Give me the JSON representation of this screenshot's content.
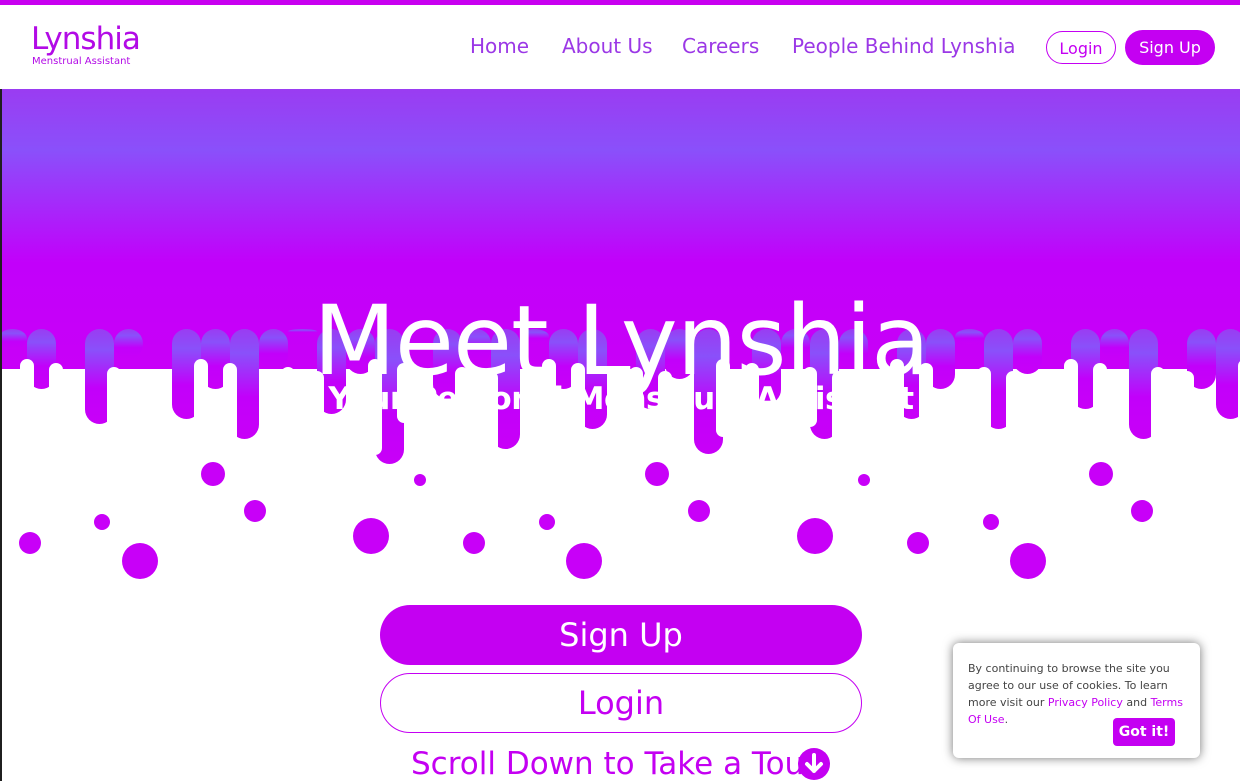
{
  "brand": {
    "name": "Lynshia",
    "tagline": "Menstrual Assistant"
  },
  "nav": {
    "links": [
      "Home",
      "About Us",
      "Careers",
      "People Behind Lynshia"
    ],
    "login_label": "Login",
    "signup_label": "Sign Up"
  },
  "hero": {
    "title": "Meet Lynshia",
    "subtitle": "Your Personal Menstrual Assistant"
  },
  "cta": {
    "signup_label": "Sign Up",
    "login_label": "Login",
    "tour_label": "Scroll Down to Take a Tour",
    "tour_icon": "arrow-down-circle-icon"
  },
  "cookie": {
    "text_before": "By continuing to browse the site you agree to our use of cookies. To learn more visit our",
    "privacy_link": "Privacy Policy",
    "and_text": "and",
    "terms_link": "Terms Of Use",
    "period": ".",
    "button_label": "Got it!"
  },
  "colors": {
    "accent": "#c400f2",
    "gradient_top": "#9a3cf2",
    "gradient_mid": "#8a50fa",
    "gradient_bottom": "#c800f8"
  }
}
